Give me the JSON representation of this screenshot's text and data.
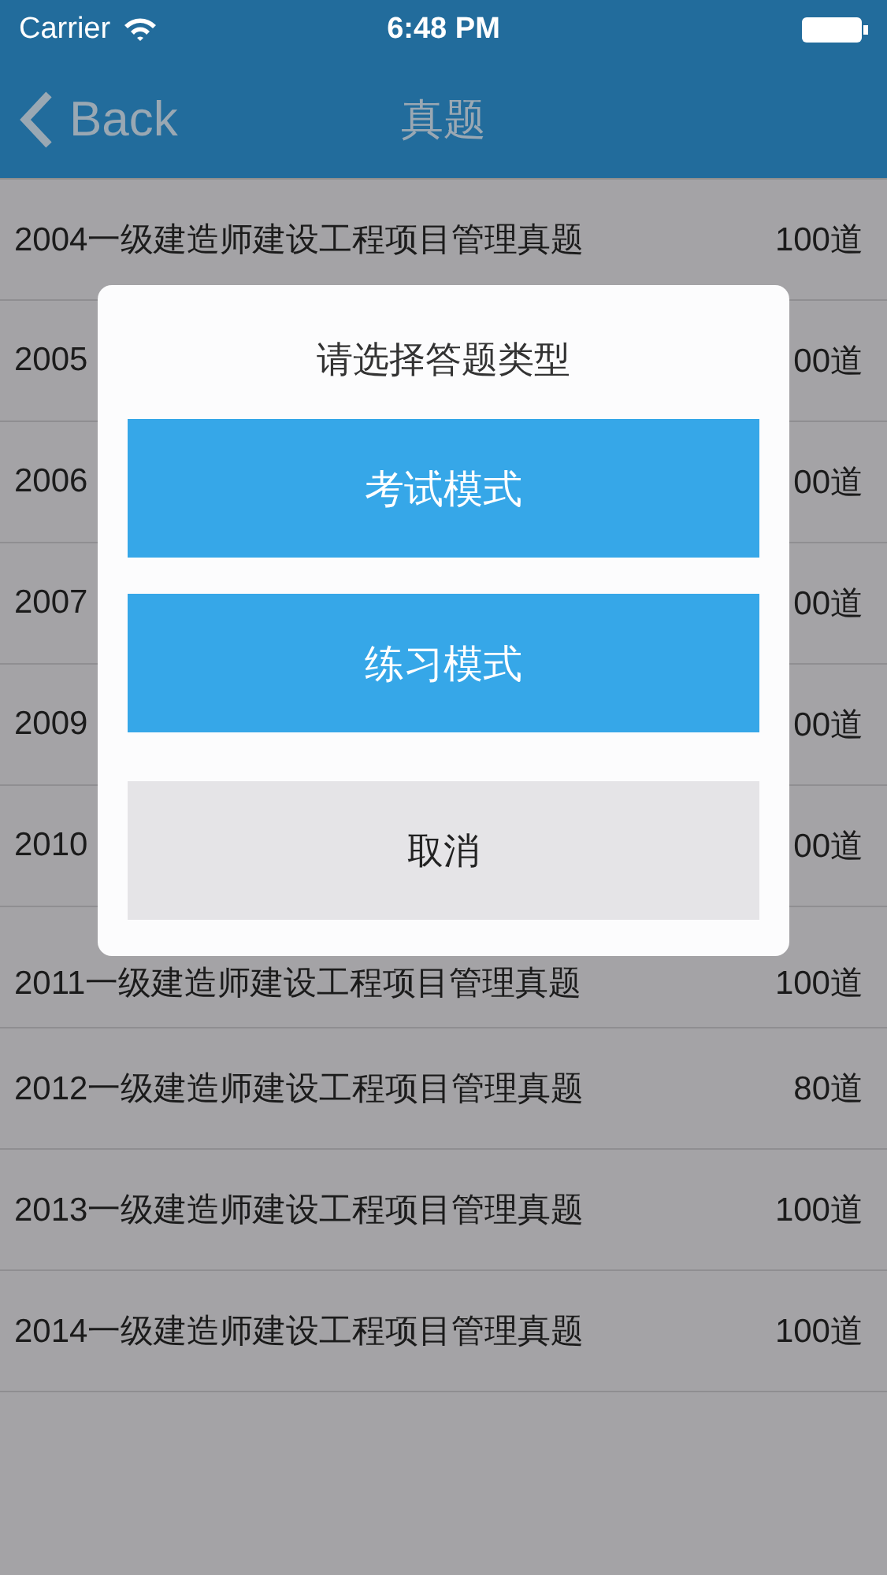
{
  "status_bar": {
    "carrier": "Carrier",
    "time": "6:48 PM"
  },
  "nav": {
    "back": "Back",
    "title": "真题"
  },
  "rows": [
    {
      "title": "2004一级建造师建设工程项目管理真题",
      "count": "100道"
    },
    {
      "title": "2005",
      "count": "00道"
    },
    {
      "title": "2006",
      "count": "00道"
    },
    {
      "title": "2007",
      "count": "00道"
    },
    {
      "title": "2009",
      "count": "00道"
    },
    {
      "title": "2010",
      "count": "00道"
    },
    {
      "title": "2011一级建造师建设工程项目管理真题",
      "count": "100道"
    },
    {
      "title": "2012一级建造师建设工程项目管理真题",
      "count": "80道"
    },
    {
      "title": "2013一级建造师建设工程项目管理真题",
      "count": "100道"
    },
    {
      "title": "2014一级建造师建设工程项目管理真题",
      "count": "100道"
    }
  ],
  "dialog": {
    "title": "请选择答题类型",
    "buttons": [
      {
        "label": "考试模式",
        "kind": "primary"
      },
      {
        "label": "练习模式",
        "kind": "primary"
      },
      {
        "label": "取消",
        "kind": "cancel"
      }
    ]
  }
}
